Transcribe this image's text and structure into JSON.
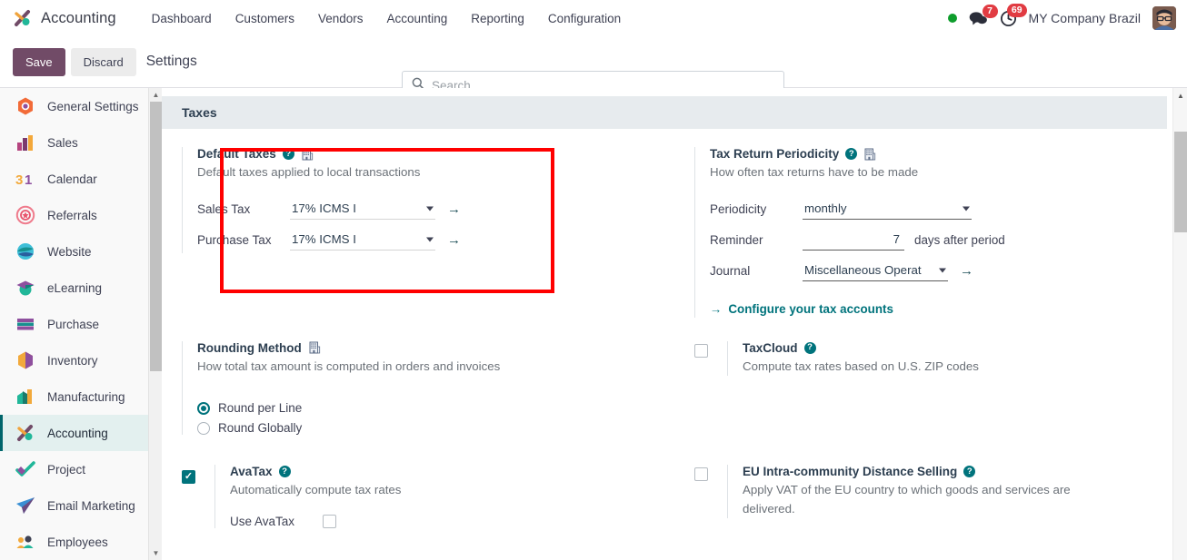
{
  "navbar": {
    "brand": "Accounting",
    "menu": [
      {
        "label": "Dashboard"
      },
      {
        "label": "Customers"
      },
      {
        "label": "Vendors"
      },
      {
        "label": "Accounting"
      },
      {
        "label": "Reporting"
      },
      {
        "label": "Configuration"
      }
    ],
    "status_dot_color": "#0e9d2c",
    "messages_badge": "7",
    "activities_badge": "69",
    "company": "MY Company Brazil"
  },
  "control_panel": {
    "save_label": "Save",
    "discard_label": "Discard",
    "title": "Settings",
    "search_placeholder": "Search...",
    "search_value": ""
  },
  "sidebar": {
    "items": [
      {
        "label": "General Settings",
        "active": false
      },
      {
        "label": "Sales",
        "active": false
      },
      {
        "label": "Calendar",
        "active": false
      },
      {
        "label": "Referrals",
        "active": false
      },
      {
        "label": "Website",
        "active": false
      },
      {
        "label": "eLearning",
        "active": false
      },
      {
        "label": "Purchase",
        "active": false
      },
      {
        "label": "Inventory",
        "active": false
      },
      {
        "label": "Manufacturing",
        "active": false
      },
      {
        "label": "Accounting",
        "active": true
      },
      {
        "label": "Project",
        "active": false
      },
      {
        "label": "Email Marketing",
        "active": false
      },
      {
        "label": "Employees",
        "active": false
      }
    ]
  },
  "section": {
    "header": "Taxes"
  },
  "default_taxes": {
    "title": "Default Taxes",
    "description": "Default taxes applied to local transactions",
    "sales_tax_label": "Sales Tax",
    "sales_tax_value": "17% ICMS I",
    "purchase_tax_label": "Purchase Tax",
    "purchase_tax_value": "17% ICMS I"
  },
  "tax_return_periodicity": {
    "title": "Tax Return Periodicity",
    "description": "How often tax returns have to be made",
    "periodicity_label": "Periodicity",
    "periodicity_value": "monthly",
    "reminder_label": "Reminder",
    "reminder_value": "7",
    "reminder_suffix": "days after period",
    "journal_label": "Journal",
    "journal_value": "Miscellaneous Operat",
    "configure_link": "Configure your tax accounts"
  },
  "rounding_method": {
    "title": "Rounding Method",
    "description": "How total tax amount is computed in orders and invoices",
    "options": [
      {
        "label": "Round per Line",
        "selected": true
      },
      {
        "label": "Round Globally",
        "selected": false
      }
    ]
  },
  "taxcloud": {
    "title": "TaxCloud",
    "description": "Compute tax rates based on U.S. ZIP codes",
    "checked": false
  },
  "avatax": {
    "title": "AvaTax",
    "description": "Automatically compute tax rates",
    "checked": true,
    "sub_label": "Use AvaTax",
    "sub_checked": false
  },
  "eu_distance_selling": {
    "title": "EU Intra-community Distance Selling",
    "description": "Apply VAT of the EU country to which goods and services are delivered.",
    "checked": false
  },
  "colors": {
    "accent_teal": "#00737c",
    "save_purple": "#714b67",
    "badge_red": "#e13b42",
    "annotation_red": "#ff0000"
  }
}
